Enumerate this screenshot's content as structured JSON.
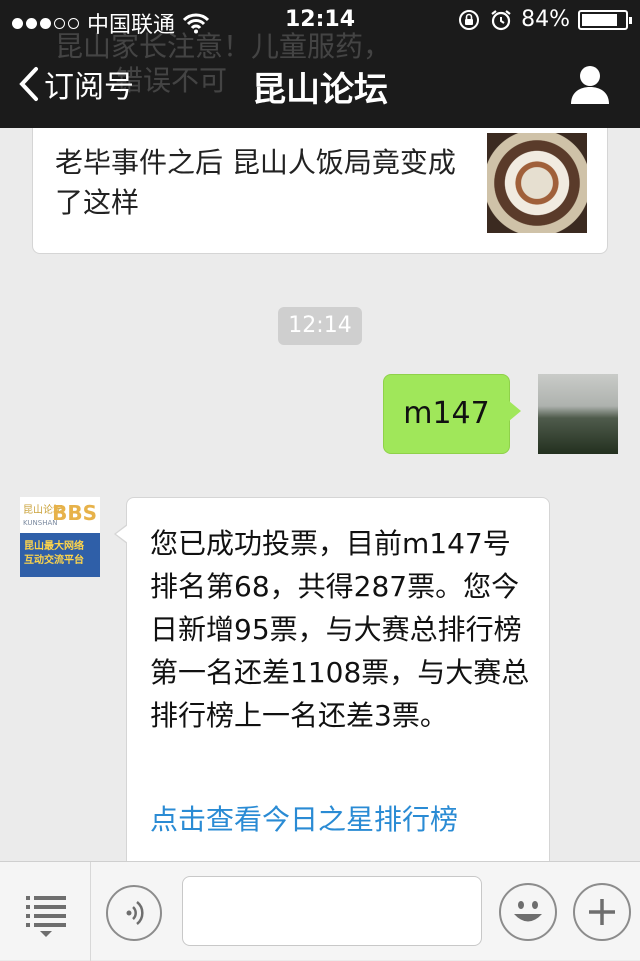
{
  "status_bar": {
    "carrier": "中国联通",
    "time": "12:14",
    "battery_percent": "84%",
    "battery_level": 0.84,
    "signal_bars_filled": 3,
    "signal_bars_total": 5,
    "icons": [
      "signal-dots-icon",
      "wifi-icon",
      "orientation-lock-icon",
      "alarm-icon",
      "battery-icon"
    ]
  },
  "nav": {
    "back_label": "订阅号",
    "title": "昆山论坛",
    "ghost_text_line1": "昆山家长注意！儿童服药，",
    "ghost_text_line2": "错误不可",
    "icons": [
      "chevron-left-icon",
      "profile-icon"
    ]
  },
  "article_card": {
    "title": "老毕事件之后 昆山人饭局竟变成了这样"
  },
  "timestamp_pill": "12:14",
  "my_message": {
    "text": "m147"
  },
  "sender_avatar": {
    "line1_cn": "昆山论坛",
    "line1_bbs": "BBS",
    "line1_sub": "KUNSHAN",
    "line2": "昆山最大网络",
    "line3": "互动交流平台"
  },
  "reply_message": {
    "text": "您已成功投票，目前m147号排名第68，共得287票。您今日新增95票，与大赛总排行榜第一名还差1108票，与大赛总排行榜上一名还差3票。",
    "link": "点击查看今日之星排行榜"
  },
  "input_bar": {
    "input_value": "",
    "icons": [
      "menu-icon",
      "voice-icon",
      "emoji-icon",
      "plus-icon"
    ]
  },
  "colors": {
    "header_bg": "#1b1b1b",
    "chat_bg": "#ebebeb",
    "sent_bubble": "#a0e75a",
    "link": "#2a8bd4"
  }
}
